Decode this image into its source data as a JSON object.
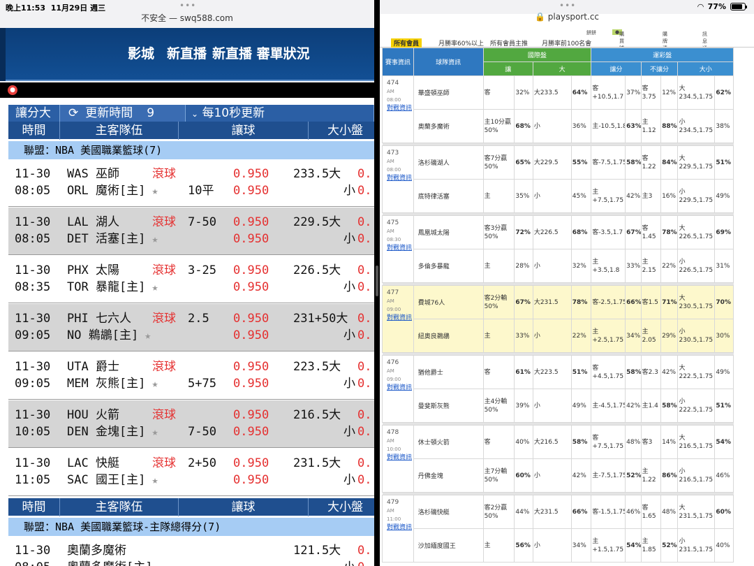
{
  "left_status": {
    "time": "晚上11:53",
    "date": "11月29日 週三",
    "url": "不安全 — swq588.com"
  },
  "right_status": {
    "url": "playsport.cc",
    "battery": "77%",
    "battery_level": 0.77
  },
  "left_nav": {
    "items": [
      "影城",
      "新直播",
      "新直播 審單狀況"
    ]
  },
  "left_toolbar": {
    "mode": "讓分大",
    "refresh_label": "更新時間",
    "refresh_value": "9",
    "interval": "每10秒更新"
  },
  "left_columns": {
    "time": "時間",
    "teams": "主客隊伍",
    "handicap": "讓球",
    "ou": "大小盤"
  },
  "leagues": [
    "聯盟：NBA 美國職業籃球(7)",
    "聯盟：NBA 美國職業籃球-主隊總得分(7)"
  ],
  "games": [
    {
      "date": "11-30",
      "time": "08:05",
      "away": "WAS 巫師",
      "home": "ORL 魔術[主]",
      "live": "滾球",
      "hc1": "",
      "hc2": "10平",
      "odd1": "0.950",
      "odd2": "0.950",
      "ou1": "233.5大",
      "ou2": "小",
      "ou_odd": "0."
    },
    {
      "date": "11-30",
      "time": "08:05",
      "away": "LAL 湖人",
      "home": "DET 活塞[主]",
      "live": "滾球",
      "hc1": "7-50",
      "hc2": "",
      "odd1": "0.950",
      "odd2": "0.950",
      "ou1": "229.5大",
      "ou2": "小",
      "ou_odd": "0."
    },
    {
      "date": "11-30",
      "time": "08:35",
      "away": "PHX 太陽",
      "home": "TOR 暴龍[主]",
      "live": "滾球",
      "hc1": "3-25",
      "hc2": "",
      "odd1": "0.950",
      "odd2": "0.950",
      "ou1": "226.5大",
      "ou2": "小",
      "ou_odd": "0."
    },
    {
      "date": "11-30",
      "time": "09:05",
      "away": "PHI 七六人",
      "home": "NO 鵜鶘[主]",
      "live": "滾球",
      "hc1": "2.5",
      "hc2": "",
      "odd1": "0.950",
      "odd2": "0.950",
      "ou1": "231+50大",
      "ou2": "小",
      "ou_odd": "0."
    },
    {
      "date": "11-30",
      "time": "09:05",
      "away": "UTA 爵士",
      "home": "MEM 灰熊[主]",
      "live": "滾球",
      "hc1": "",
      "hc2": "5+75",
      "odd1": "0.950",
      "odd2": "0.950",
      "ou1": "223.5大",
      "ou2": "小",
      "ou_odd": "0."
    },
    {
      "date": "11-30",
      "time": "10:05",
      "away": "HOU 火箭",
      "home": "DEN 金塊[主]",
      "live": "滾球",
      "hc1": "",
      "hc2": "7-50",
      "odd1": "0.950",
      "odd2": "0.950",
      "ou1": "216.5大",
      "ou2": "小",
      "ou_odd": "0."
    },
    {
      "date": "11-30",
      "time": "11:05",
      "away": "LAC 快艇",
      "home": "SAC 國王[主]",
      "live": "滾球",
      "hc1": "2+50",
      "hc2": "",
      "odd1": "0.950",
      "odd2": "0.950",
      "ou1": "231.5大",
      "ou2": "小",
      "ou_odd": "0."
    }
  ],
  "total_game": {
    "date": "11-30",
    "time": "08:05",
    "away": "奧蘭多魔術",
    "home": "奧蘭多魔術[主]",
    "ou1": "121.5大",
    "ou2": "小",
    "ou_odd": "0."
  },
  "right_top": {
    "menu": "餅餅",
    "items": [
      "購買噓幣",
      "購牌清單",
      "訊息通知"
    ]
  },
  "right_tabs": [
    "所有會員",
    "月勝率60%以上",
    "所有會員主推",
    "月勝率前100名會"
  ],
  "right_header": {
    "info": "賽事資訊",
    "team_info": "球隊資訊",
    "intl": "國際盤",
    "sports": "運彩盤",
    "rang": "讓",
    "da": "大",
    "rangfen": "讓分",
    "bu": "不讓分",
    "dx": "大小"
  },
  "matches": [
    {
      "no": "474",
      "ap": "AM",
      "time": "08:00",
      "link": "對戰資訊",
      "hl": false,
      "a": {
        "team": "華盛頓巫師",
        "c1": "客",
        "p1": "32%",
        "c2": "大233.5",
        "p2": "64%",
        "c3": "客+10.5,1.7",
        "p3": "37%",
        "c4": "客3.75",
        "p4": "12%",
        "c5": "大234.5,1.75",
        "p5": "62%"
      },
      "h": {
        "team": "奧蘭多魔術",
        "c1": "主10分贏50%",
        "p1": "68%",
        "c2": "小",
        "p2": "36%",
        "c3": "主-10.5,1.8",
        "p3": "63%",
        "c4": "主1.12",
        "p4": "88%",
        "c5": "小234.5,1.75",
        "p5": "38%"
      }
    },
    {
      "no": "473",
      "ap": "AM",
      "time": "08:00",
      "link": "對戰資訊",
      "hl": false,
      "a": {
        "team": "洛杉磯湖人",
        "c1": "客7分贏50%",
        "p1": "65%",
        "c2": "大229.5",
        "p2": "55%",
        "c3": "客-7.5,1.75",
        "p3": "58%",
        "c4": "客1.22",
        "p4": "84%",
        "c5": "大229.5,1.75",
        "p5": "51%"
      },
      "h": {
        "team": "底特律活塞",
        "c1": "主",
        "p1": "35%",
        "c2": "小",
        "p2": "45%",
        "c3": "主+7.5,1.75",
        "p3": "42%",
        "c4": "主3",
        "p4": "16%",
        "c5": "小229.5,1.75",
        "p5": "49%"
      }
    },
    {
      "no": "475",
      "ap": "AM",
      "time": "08:30",
      "link": "對戰資訊",
      "hl": false,
      "a": {
        "team": "鳳凰城太陽",
        "c1": "客3分贏50%",
        "p1": "72%",
        "c2": "大226.5",
        "p2": "68%",
        "c3": "客-3.5,1.7",
        "p3": "67%",
        "c4": "客1.45",
        "p4": "78%",
        "c5": "大226.5,1.75",
        "p5": "69%"
      },
      "h": {
        "team": "多倫多暴龍",
        "c1": "主",
        "p1": "28%",
        "c2": "小",
        "p2": "32%",
        "c3": "主+3.5,1.8",
        "p3": "33%",
        "c4": "主2.15",
        "p4": "22%",
        "c5": "小226.5,1.75",
        "p5": "31%"
      }
    },
    {
      "no": "477",
      "ap": "AM",
      "time": "09:00",
      "link": "對戰資訊",
      "hl": true,
      "a": {
        "team": "費城76人",
        "c1": "客2分輸50%",
        "p1": "67%",
        "c2": "大231.5",
        "p2": "78%",
        "c3": "客-2.5,1.75",
        "p3": "66%",
        "c4": "客1.5",
        "p4": "71%",
        "c5": "大230.5,1.75",
        "p5": "70%"
      },
      "h": {
        "team": "紐奧良鵜鶘",
        "c1": "主",
        "p1": "33%",
        "c2": "小",
        "p2": "22%",
        "c3": "主+2.5,1.75",
        "p3": "34%",
        "c4": "主2.05",
        "p4": "29%",
        "c5": "小230.5,1.75",
        "p5": "30%"
      }
    },
    {
      "no": "476",
      "ap": "AM",
      "time": "09:00",
      "link": "對戰資訊",
      "hl": false,
      "a": {
        "team": "猶他爵士",
        "c1": "客",
        "p1": "61%",
        "c2": "大223.5",
        "p2": "51%",
        "c3": "客+4.5,1.75",
        "p3": "58%",
        "c4": "客2.3",
        "p4": "42%",
        "c5": "大222.5,1.75",
        "p5": "49%"
      },
      "h": {
        "team": "曼斐斯灰熊",
        "c1": "主4分輸50%",
        "p1": "39%",
        "c2": "小",
        "p2": "49%",
        "c3": "主-4.5,1.75",
        "p3": "42%",
        "c4": "主1.4",
        "p4": "58%",
        "c5": "小222.5,1.75",
        "p5": "51%"
      }
    },
    {
      "no": "478",
      "ap": "AM",
      "time": "10:00",
      "link": "對戰資訊",
      "hl": false,
      "a": {
        "team": "休士頓火箭",
        "c1": "客",
        "p1": "40%",
        "c2": "大216.5",
        "p2": "58%",
        "c3": "客+7.5,1.75",
        "p3": "48%",
        "c4": "客3",
        "p4": "14%",
        "c5": "大216.5,1.75",
        "p5": "54%"
      },
      "h": {
        "team": "丹佛金塊",
        "c1": "主7分輸50%",
        "p1": "60%",
        "c2": "小",
        "p2": "42%",
        "c3": "主-7.5,1.75",
        "p3": "52%",
        "c4": "主1.22",
        "p4": "86%",
        "c5": "小216.5,1.75",
        "p5": "46%"
      }
    },
    {
      "no": "479",
      "ap": "AM",
      "time": "11:00",
      "link": "對戰資訊",
      "hl": false,
      "a": {
        "team": "洛杉磯快艇",
        "c1": "客2分贏50%",
        "p1": "44%",
        "c2": "大231.5",
        "p2": "66%",
        "c3": "客-1.5,1.75",
        "p3": "46%",
        "c4": "客1.65",
        "p4": "48%",
        "c5": "大231.5,1.75",
        "p5": "60%"
      },
      "h": {
        "team": "沙加緬度國王",
        "c1": "主",
        "p1": "56%",
        "c2": "小",
        "p2": "34%",
        "c3": "主+1.5,1.75",
        "p3": "54%",
        "c4": "主1.85",
        "p4": "52%",
        "c5": "小231.5,1.75",
        "p5": "40%"
      }
    }
  ]
}
